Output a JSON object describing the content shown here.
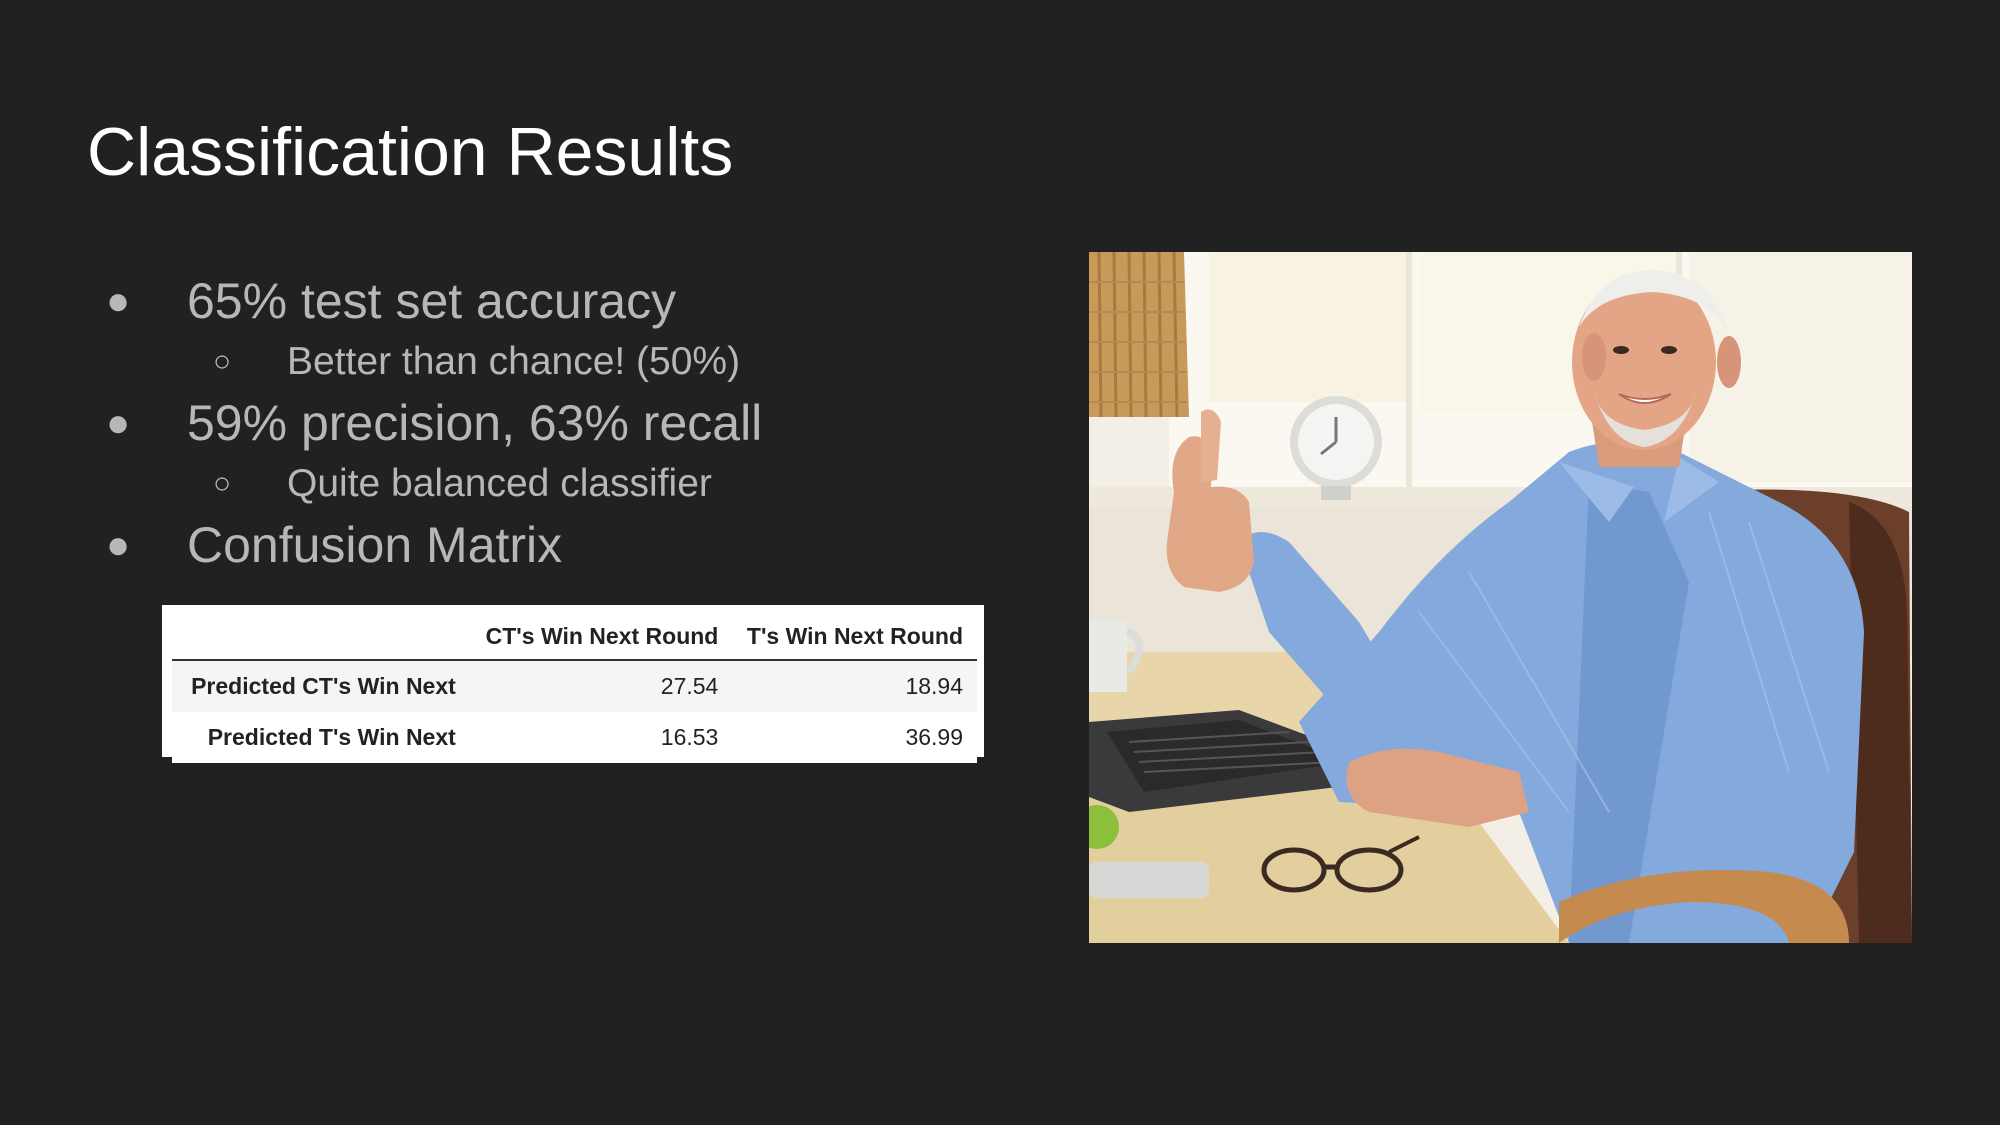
{
  "slide": {
    "title": "Classification Results"
  },
  "bullets": [
    {
      "level": 1,
      "marker": "●",
      "text": "65% test set accuracy"
    },
    {
      "level": 2,
      "marker": "○",
      "text": "Better than chance! (50%)"
    },
    {
      "level": 1,
      "marker": "●",
      "text": "59% precision, 63% recall"
    },
    {
      "level": 2,
      "marker": "○",
      "text": "Quite balanced classifier"
    },
    {
      "level": 1,
      "marker": "●",
      "text": "Confusion Matrix"
    }
  ],
  "confusion_matrix": {
    "columns": [
      "",
      "CT's Win Next Round",
      "T's Win Next Round"
    ],
    "rows": [
      {
        "label": "Predicted CT's Win Next",
        "values": [
          "27.54",
          "18.94"
        ]
      },
      {
        "label": "Predicted T's Win Next",
        "values": [
          "16.53",
          "36.99"
        ]
      }
    ]
  },
  "photo": {
    "subject": "smiling-man-thumbs-up-photo"
  }
}
